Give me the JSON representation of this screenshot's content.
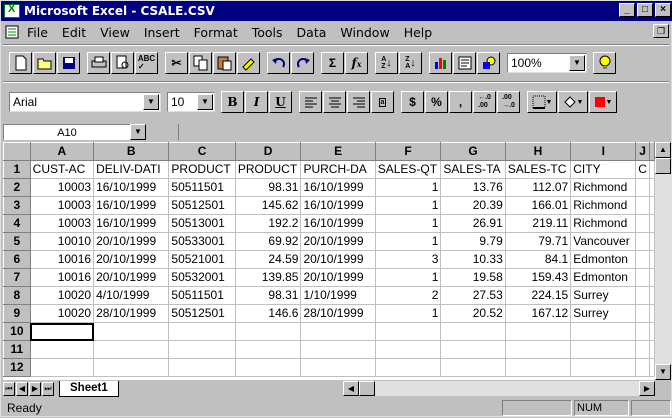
{
  "window": {
    "title": "Microsoft Excel - CSALE.CSV"
  },
  "menu": [
    "File",
    "Edit",
    "View",
    "Insert",
    "Format",
    "Tools",
    "Data",
    "Window",
    "Help"
  ],
  "toolbar": {
    "zoom": "100%"
  },
  "formatting": {
    "font": "Arial",
    "size": "10",
    "bold": "B",
    "italic": "I",
    "underline": "U",
    "currency": "$",
    "percent": "%",
    "comma": ","
  },
  "namebox": {
    "cell": "A10"
  },
  "sheet": {
    "columns": [
      "A",
      "B",
      "C",
      "D",
      "E",
      "F",
      "G",
      "H",
      "I",
      "J"
    ],
    "rows": [
      {
        "n": "1",
        "cells": [
          "CUST-AC",
          "DELIV-DATI",
          "PRODUCT",
          "PRODUCT",
          "PURCH-DA",
          "SALES-QT",
          "SALES-TA",
          "SALES-TC",
          "CITY",
          "C"
        ]
      },
      {
        "n": "2",
        "cells": [
          "10003",
          "16/10/1999",
          "50511501",
          "98.31",
          "16/10/1999",
          "1",
          "13.76",
          "112.07",
          "Richmond",
          ""
        ]
      },
      {
        "n": "3",
        "cells": [
          "10003",
          "16/10/1999",
          "50512501",
          "145.62",
          "16/10/1999",
          "1",
          "20.39",
          "166.01",
          "Richmond",
          ""
        ]
      },
      {
        "n": "4",
        "cells": [
          "10003",
          "16/10/1999",
          "50513001",
          "192.2",
          "16/10/1999",
          "1",
          "26.91",
          "219.11",
          "Richmond",
          ""
        ]
      },
      {
        "n": "5",
        "cells": [
          "10010",
          "20/10/1999",
          "50533001",
          "69.92",
          "20/10/1999",
          "1",
          "9.79",
          "79.71",
          "Vancouver",
          ""
        ]
      },
      {
        "n": "6",
        "cells": [
          "10016",
          "20/10/1999",
          "50521001",
          "24.59",
          "20/10/1999",
          "3",
          "10.33",
          "84.1",
          "Edmonton",
          ""
        ]
      },
      {
        "n": "7",
        "cells": [
          "10016",
          "20/10/1999",
          "50532001",
          "139.85",
          "20/10/1999",
          "1",
          "19.58",
          "159.43",
          "Edmonton",
          ""
        ]
      },
      {
        "n": "8",
        "cells": [
          "10020",
          "4/10/1999",
          "50511501",
          "98.31",
          "1/10/1999",
          "2",
          "27.53",
          "224.15",
          "Surrey",
          ""
        ]
      },
      {
        "n": "9",
        "cells": [
          "10020",
          "28/10/1999",
          "50512501",
          "146.6",
          "28/10/1999",
          "1",
          "20.52",
          "167.12",
          "Surrey",
          ""
        ]
      },
      {
        "n": "10",
        "cells": [
          "",
          "",
          "",
          "",
          "",
          "",
          "",
          "",
          "",
          ""
        ]
      },
      {
        "n": "11",
        "cells": [
          "",
          "",
          "",
          "",
          "",
          "",
          "",
          "",
          "",
          ""
        ]
      },
      {
        "n": "12",
        "cells": [
          "",
          "",
          "",
          "",
          "",
          "",
          "",
          "",
          "",
          ""
        ]
      }
    ]
  },
  "sheet_tab": "Sheet1",
  "status": {
    "text": "Ready",
    "num": "NUM"
  }
}
